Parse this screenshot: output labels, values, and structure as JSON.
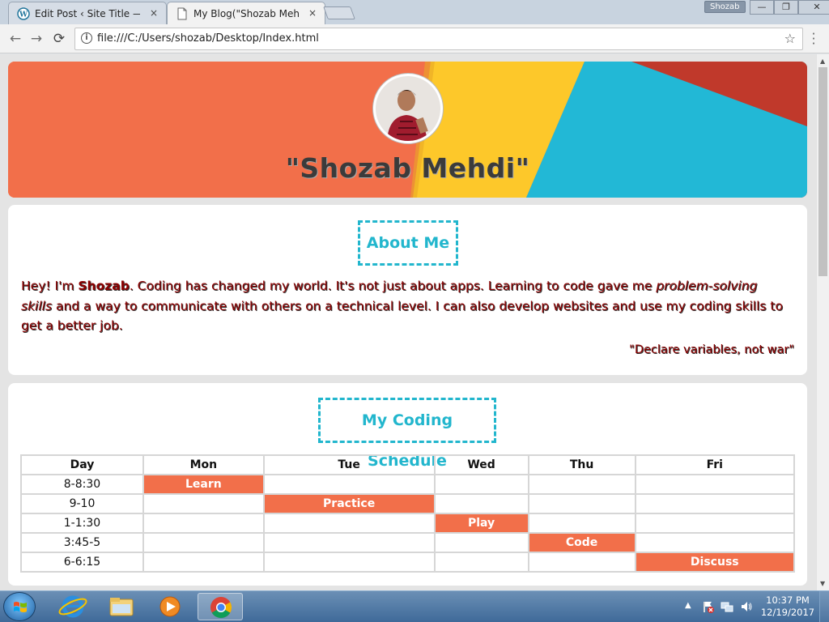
{
  "browser": {
    "tabs": [
      {
        "title": "Edit Post ‹ Site Title — W",
        "close": "×"
      },
      {
        "title": "My Blog(\"Shozab Mehdi\")",
        "close": "×"
      }
    ],
    "user_badge": "Shozab",
    "window_controls": {
      "minimize": "—",
      "maximize": "❐",
      "close": "✕"
    },
    "nav": {
      "back": "←",
      "forward": "→",
      "reload": "⟳"
    },
    "address": "file:///C:/Users/shozab/Desktop/Index.html",
    "info_icon": "i",
    "bookmark_icon": "☆",
    "menu_icon": "⋮"
  },
  "page": {
    "hero": {
      "title": "\"Shozab Mehdi\"",
      "colors": {
        "orange": "#f26f4a",
        "yellow": "#fdc82a",
        "teal": "#22b8d6",
        "red": "#c0392b"
      }
    },
    "about": {
      "heading": "About Me",
      "text_part1": "Hey! I'm ",
      "text_name": "Shozab",
      "text_part2": ". Coding has changed my world. It's not just about apps. Learning to code gave me ",
      "text_italic": "problem-solving skills",
      "text_part3": " and a way to communicate with others on a technical level. I can also develop websites and use my coding skills to get a better job.",
      "quote": "\"Declare variables, not war\""
    },
    "schedule": {
      "heading": "My Coding Schedule",
      "columns": [
        "Day",
        "Mon",
        "Tue",
        "Wed",
        "Thu",
        "Fri"
      ],
      "rows": [
        {
          "time": "8-8:30",
          "cells": [
            "Learn",
            "",
            "",
            "",
            ""
          ]
        },
        {
          "time": "9-10",
          "cells": [
            "",
            "Practice",
            "",
            "",
            ""
          ]
        },
        {
          "time": "1-1:30",
          "cells": [
            "",
            "",
            "Play",
            "",
            ""
          ]
        },
        {
          "time": "3:45-5",
          "cells": [
            "",
            "",
            "",
            "Code",
            ""
          ]
        },
        {
          "time": "6-6:15",
          "cells": [
            "",
            "",
            "",
            "",
            "Discuss"
          ]
        }
      ],
      "accent_color": "#f26f4a"
    }
  },
  "taskbar": {
    "apps": [
      "internet-explorer-icon",
      "file-explorer-icon",
      "media-player-icon",
      "chrome-icon"
    ],
    "tray_arrow": "▲",
    "time": "10:37 PM",
    "date": "12/19/2017"
  }
}
